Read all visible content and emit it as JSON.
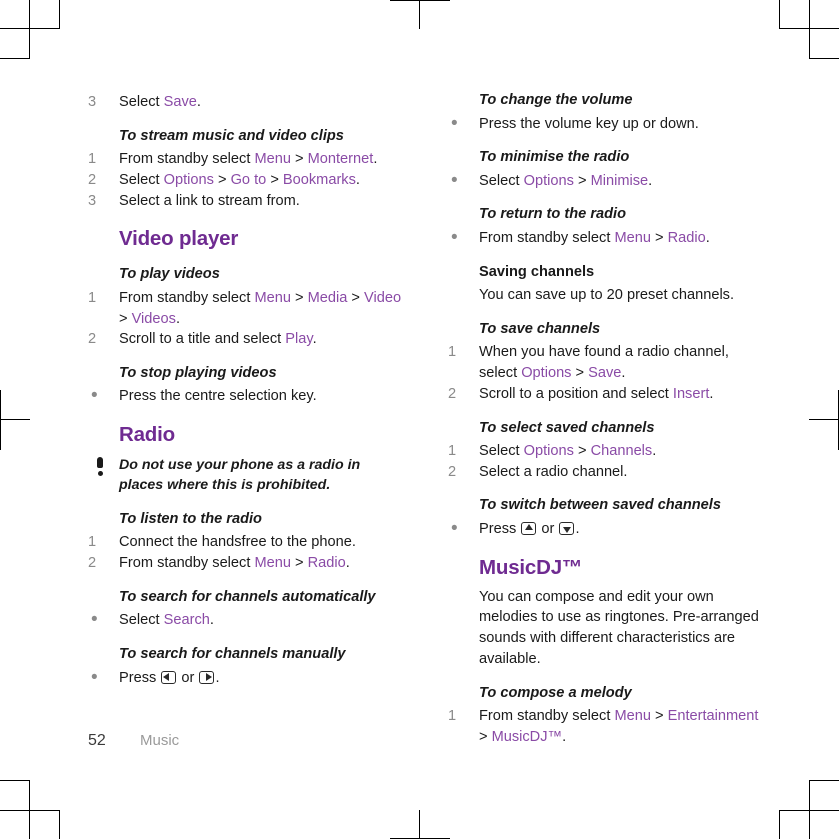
{
  "page": {
    "number": "52",
    "chapter": "Music",
    "accent_heading_color": "#6f2b91",
    "accent_link_color": "#8a4ba6",
    "marker_color": "#8a8a8a"
  },
  "left_column": {
    "step_save": {
      "marker": "3",
      "text_before": "Select ",
      "link": "Save",
      "text_after": "."
    },
    "stream_clips": {
      "heading": "To stream music and video clips",
      "steps": [
        {
          "marker": "1",
          "parts": [
            {
              "kind": "plain",
              "text": "From standby select "
            },
            {
              "kind": "link",
              "text": "Menu"
            },
            {
              "kind": "plain",
              "text": " > "
            },
            {
              "kind": "link",
              "text": "Monternet"
            },
            {
              "kind": "plain",
              "text": "."
            }
          ]
        },
        {
          "marker": "2",
          "parts": [
            {
              "kind": "plain",
              "text": "Select "
            },
            {
              "kind": "link",
              "text": "Options"
            },
            {
              "kind": "plain",
              "text": " > "
            },
            {
              "kind": "link",
              "text": "Go to"
            },
            {
              "kind": "plain",
              "text": " > "
            },
            {
              "kind": "link",
              "text": "Bookmarks"
            },
            {
              "kind": "plain",
              "text": "."
            }
          ]
        },
        {
          "marker": "3",
          "parts": [
            {
              "kind": "plain",
              "text": "Select a link to stream from."
            }
          ]
        }
      ]
    },
    "video_player": {
      "heading": "Video player",
      "play_videos": {
        "heading": "To play videos",
        "steps": [
          {
            "marker": "1",
            "parts": [
              {
                "kind": "plain",
                "text": "From standby select "
              },
              {
                "kind": "link",
                "text": "Menu"
              },
              {
                "kind": "plain",
                "text": " > "
              },
              {
                "kind": "link",
                "text": "Media"
              },
              {
                "kind": "plain",
                "text": " > "
              },
              {
                "kind": "link",
                "text": "Video"
              },
              {
                "kind": "plain",
                "text": " > "
              },
              {
                "kind": "link",
                "text": "Videos"
              },
              {
                "kind": "plain",
                "text": "."
              }
            ]
          },
          {
            "marker": "2",
            "parts": [
              {
                "kind": "plain",
                "text": "Scroll to a title and select "
              },
              {
                "kind": "link",
                "text": "Play"
              },
              {
                "kind": "plain",
                "text": "."
              }
            ]
          }
        ]
      },
      "stop_videos": {
        "heading": "To stop playing videos",
        "steps": [
          {
            "marker": "•",
            "parts": [
              {
                "kind": "plain",
                "text": "Press the centre selection key."
              }
            ]
          }
        ]
      }
    },
    "radio": {
      "heading": "Radio",
      "note": "Do not use your phone as a radio in places where this is prohibited.",
      "note_icon": "exclamation-icon",
      "listen": {
        "heading": "To listen to the radio",
        "steps": [
          {
            "marker": "1",
            "parts": [
              {
                "kind": "plain",
                "text": "Connect the handsfree to the phone."
              }
            ]
          },
          {
            "marker": "2",
            "parts": [
              {
                "kind": "plain",
                "text": "From standby select "
              },
              {
                "kind": "link",
                "text": "Menu"
              },
              {
                "kind": "plain",
                "text": " > "
              },
              {
                "kind": "link",
                "text": "Radio"
              },
              {
                "kind": "plain",
                "text": "."
              }
            ]
          }
        ]
      },
      "search_auto": {
        "heading": "To search for channels automatically",
        "steps": [
          {
            "marker": "•",
            "parts": [
              {
                "kind": "plain",
                "text": "Select "
              },
              {
                "kind": "link",
                "text": "Search"
              },
              {
                "kind": "plain",
                "text": "."
              }
            ]
          }
        ]
      },
      "search_manual": {
        "heading": "To search for channels manually",
        "steps": [
          {
            "marker": "•",
            "parts": [
              {
                "kind": "plain",
                "text": "Press "
              },
              {
                "kind": "key",
                "icon": "key-left-icon"
              },
              {
                "kind": "plain",
                "text": " or "
              },
              {
                "kind": "key",
                "icon": "key-right-icon"
              },
              {
                "kind": "plain",
                "text": "."
              }
            ]
          }
        ]
      }
    }
  },
  "right_column": {
    "change_volume": {
      "heading": "To change the volume",
      "steps": [
        {
          "marker": "•",
          "parts": [
            {
              "kind": "plain",
              "text": "Press the volume key up or down."
            }
          ]
        }
      ]
    },
    "minimise_radio": {
      "heading": "To minimise the radio",
      "steps": [
        {
          "marker": "•",
          "parts": [
            {
              "kind": "plain",
              "text": "Select "
            },
            {
              "kind": "link",
              "text": "Options"
            },
            {
              "kind": "plain",
              "text": " > "
            },
            {
              "kind": "link",
              "text": "Minimise"
            },
            {
              "kind": "plain",
              "text": "."
            }
          ]
        }
      ]
    },
    "return_radio": {
      "heading": "To return to the radio",
      "steps": [
        {
          "marker": "•",
          "parts": [
            {
              "kind": "plain",
              "text": "From standby select "
            },
            {
              "kind": "link",
              "text": "Menu"
            },
            {
              "kind": "plain",
              "text": " > "
            },
            {
              "kind": "link",
              "text": "Radio"
            },
            {
              "kind": "plain",
              "text": "."
            }
          ]
        }
      ]
    },
    "saving_channels": {
      "heading": "Saving channels",
      "paragraph": "You can save up to 20 preset channels."
    },
    "save_channels": {
      "heading": "To save channels",
      "steps": [
        {
          "marker": "1",
          "parts": [
            {
              "kind": "plain",
              "text": "When you have found a radio channel, select "
            },
            {
              "kind": "link",
              "text": "Options"
            },
            {
              "kind": "plain",
              "text": " > "
            },
            {
              "kind": "link",
              "text": "Save"
            },
            {
              "kind": "plain",
              "text": "."
            }
          ]
        },
        {
          "marker": "2",
          "parts": [
            {
              "kind": "plain",
              "text": "Scroll to a position and select "
            },
            {
              "kind": "link",
              "text": "Insert"
            },
            {
              "kind": "plain",
              "text": "."
            }
          ]
        }
      ]
    },
    "select_saved": {
      "heading": "To select saved channels",
      "steps": [
        {
          "marker": "1",
          "parts": [
            {
              "kind": "plain",
              "text": "Select "
            },
            {
              "kind": "link",
              "text": "Options"
            },
            {
              "kind": "plain",
              "text": " > "
            },
            {
              "kind": "link",
              "text": "Channels"
            },
            {
              "kind": "plain",
              "text": "."
            }
          ]
        },
        {
          "marker": "2",
          "parts": [
            {
              "kind": "plain",
              "text": "Select a radio channel."
            }
          ]
        }
      ]
    },
    "switch_saved": {
      "heading": "To switch between saved channels",
      "steps": [
        {
          "marker": "•",
          "parts": [
            {
              "kind": "plain",
              "text": "Press "
            },
            {
              "kind": "key",
              "icon": "key-up-icon"
            },
            {
              "kind": "plain",
              "text": " or "
            },
            {
              "kind": "key",
              "icon": "key-down-icon"
            },
            {
              "kind": "plain",
              "text": "."
            }
          ]
        }
      ]
    },
    "musicdj": {
      "heading": "MusicDJ™",
      "paragraph": "You can compose and edit your own melodies to use as ringtones. Pre-arranged sounds with different characteristics are available.",
      "compose": {
        "heading": "To compose a melody",
        "steps": [
          {
            "marker": "1",
            "parts": [
              {
                "kind": "plain",
                "text": "From standby select "
              },
              {
                "kind": "link",
                "text": "Menu"
              },
              {
                "kind": "plain",
                "text": " > "
              },
              {
                "kind": "link",
                "text": "Entertainment"
              },
              {
                "kind": "plain",
                "text": " > "
              },
              {
                "kind": "link",
                "text": "MusicDJ™"
              },
              {
                "kind": "plain",
                "text": "."
              }
            ]
          }
        ]
      }
    }
  }
}
